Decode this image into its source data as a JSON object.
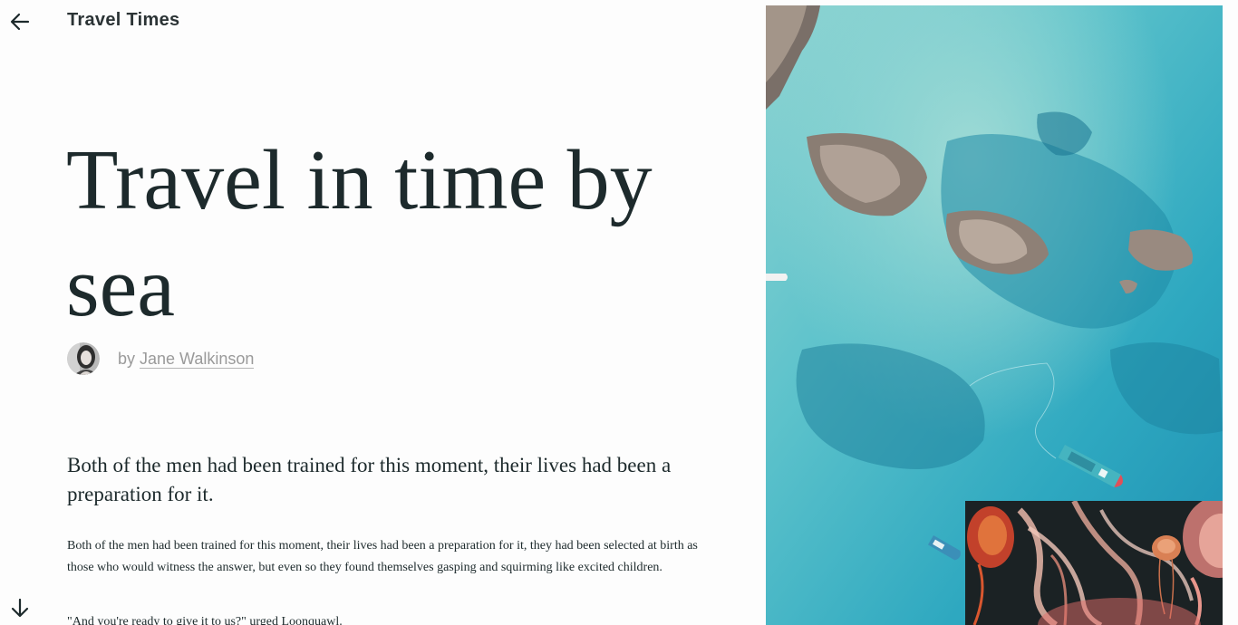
{
  "header": {
    "site_title": "Travel Times",
    "back_icon": "arrow-left-icon"
  },
  "article": {
    "title": "Travel in time by sea",
    "byline_prefix": "by",
    "author": "Jane Walkinson",
    "lead": "Both of the men had been trained for this moment, their lives had been a preparation for it.",
    "paragraphs": [
      "Both of the men had been trained for this moment, their lives had been a preparation for it, they had been selected at birth as those who would witness the answer, but even so they found themselves gasping and squirming like excited children.",
      "\"And you're ready to give it to us?\" urged Loonquawl."
    ]
  },
  "navigation": {
    "scroll_icon": "arrow-down-icon"
  },
  "media": {
    "hero_image": "aerial-sea-rocks-boats-photo",
    "inset_image": "jellyfish-photo"
  },
  "colors": {
    "text": "#1d2a2c",
    "muted": "#9a9a9a",
    "sea": "#3fb3c3",
    "background": "#fdfdfd"
  }
}
